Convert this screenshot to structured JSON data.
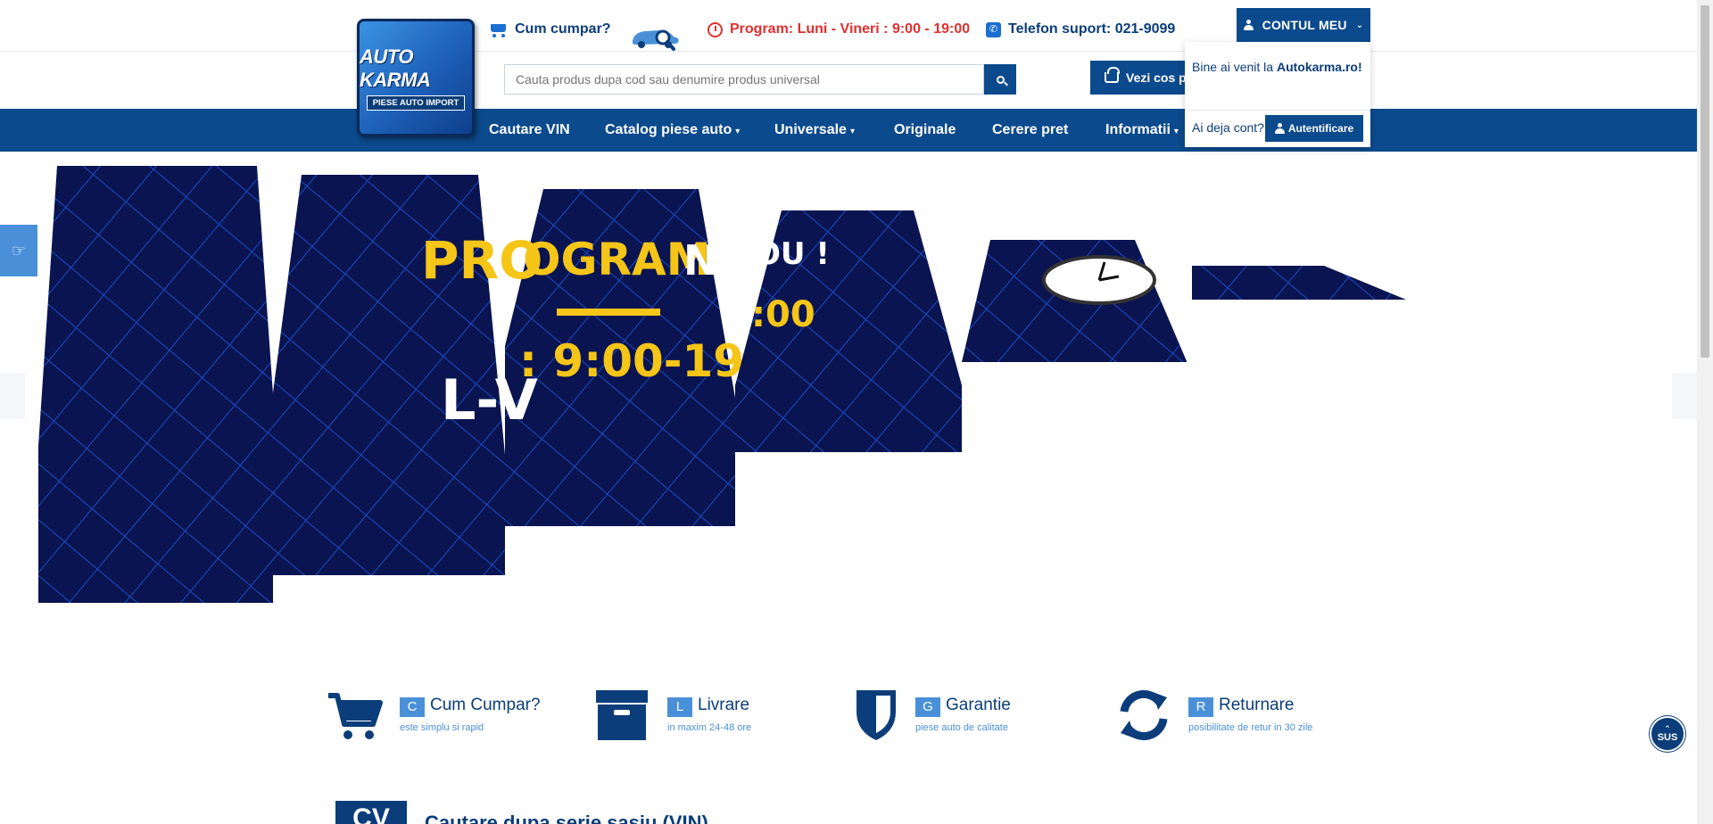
{
  "logo": {
    "brand": "AUTO KARMA",
    "subtitle": "PIESE AUTO IMPORT"
  },
  "topbar": {
    "how_to_buy": "Cum cumpar?",
    "program": "Program: Luni - Vineri : 9:00 - 19:00",
    "phone": "Telefon suport: 021-9099",
    "account_button": "CONTUL MEU"
  },
  "account_dropdown": {
    "welcome_prefix": "Bine ai venit la ",
    "welcome_site": "Autokarma.ro!",
    "have_account": "Ai deja cont?",
    "login_button": "Autentificare"
  },
  "search": {
    "placeholder": "Cauta produs dupa cod sau denumire produs universal",
    "value": ""
  },
  "cart_button": "Vezi cos pr",
  "nav": {
    "items": [
      {
        "label": "Cautare VIN",
        "caret": ""
      },
      {
        "label": "Catalog piese auto",
        "caret": "▾"
      },
      {
        "label": "Universale",
        "caret": "▾"
      },
      {
        "label": "Originale",
        "caret": ""
      },
      {
        "label": "Cerere pret",
        "caret": ""
      },
      {
        "label": "Informatii",
        "caret": "▾"
      }
    ]
  },
  "slider": {
    "headline_a": "PRO",
    "headline_b": "OGRAM",
    "headline_c": "N",
    "headline_d": "OU !",
    "hours_a": "L-V",
    "hours_b": ": 9:00-19",
    "hours_c": ":00",
    "colors": {
      "panel": "#0a1450",
      "grid": "#1a4cc4",
      "yellow": "#f5c518",
      "white": "#ffffff"
    }
  },
  "features": [
    {
      "letter": "C",
      "title": "Cum Cumpar?",
      "subtitle": "este simplu si rapid",
      "icon": "cart-icon"
    },
    {
      "letter": "L",
      "title": "Livrare",
      "subtitle": "in maxim 24-48 ore",
      "icon": "box-icon"
    },
    {
      "letter": "G",
      "title": "Garantie",
      "subtitle": "piese auto de calitate",
      "icon": "shield-icon"
    },
    {
      "letter": "R",
      "title": "Returnare",
      "subtitle": "posibilitate de retur in 30 zile",
      "icon": "refresh-icon"
    }
  ],
  "back_to_top": "SUS",
  "section_cv": {
    "badge": "CV",
    "title": "Cautare dupa serie sasiu (VIN)"
  },
  "colors": {
    "brand_blue": "#0b4a8c",
    "accent_blue": "#4a90d9",
    "accent_red": "#e0302e"
  }
}
